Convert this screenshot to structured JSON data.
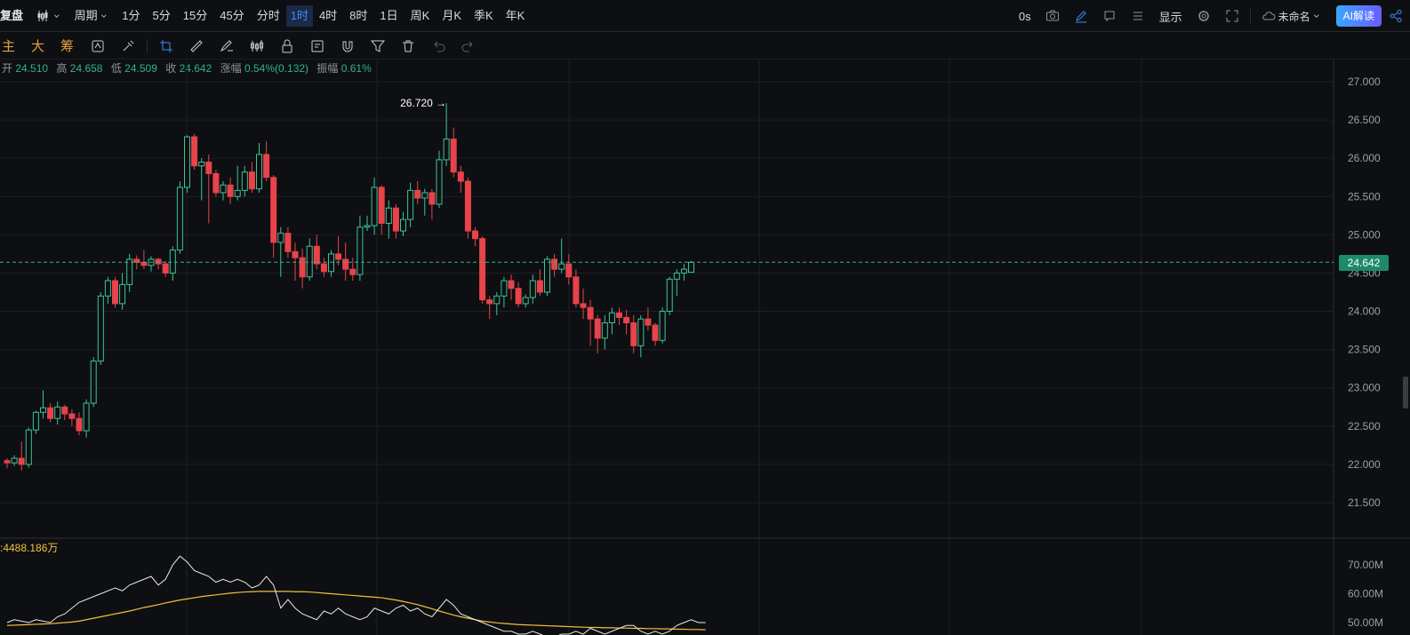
{
  "topbar": {
    "fq": "复盘",
    "period_label": "周期",
    "periods": [
      "1分",
      "5分",
      "15分",
      "45分",
      "分时",
      "1时",
      "4时",
      "8时",
      "1日",
      "周K",
      "月K",
      "季K",
      "年K"
    ],
    "active_period": "1时",
    "right": {
      "seconds": "0s",
      "display": "显示",
      "unnamed": "未命名",
      "ai": "AI解读"
    }
  },
  "toolbar2": {
    "indicators": [
      "主",
      "大",
      "筹"
    ]
  },
  "ohlc": {
    "open_label": "开",
    "open": "24.510",
    "high_label": "高",
    "high": "24.658",
    "low_label": "低",
    "low": "24.509",
    "close_label": "收",
    "close": "24.642",
    "chg_label": "涨幅",
    "chg": "0.54%(0.132)",
    "amp_label": "振幅",
    "amp": "0.61%"
  },
  "max_label": "26.720",
  "last_price": "24.642",
  "volume_label": ":4488.186万",
  "y_ticks": [
    "27.000",
    "26.500",
    "26.000",
    "25.500",
    "25.000",
    "24.500",
    "24.000",
    "23.500",
    "23.000",
    "22.500",
    "22.000",
    "21.500"
  ],
  "vol_ticks": [
    "70.00M",
    "60.00M",
    "50.00M"
  ],
  "colors": {
    "up": "#3cc49a",
    "down": "#e8434b",
    "grid": "#1c1f24",
    "ma": "#f0c23a",
    "line": "#e8e8e8"
  },
  "candles": [
    [
      22.05,
      22.08,
      21.95,
      22.02
    ],
    [
      22.02,
      22.12,
      21.98,
      22.08
    ],
    [
      22.08,
      22.3,
      21.92,
      22.0
    ],
    [
      22.0,
      22.48,
      21.96,
      22.45
    ],
    [
      22.45,
      22.7,
      22.4,
      22.68
    ],
    [
      22.68,
      22.97,
      22.6,
      22.74
    ],
    [
      22.74,
      22.8,
      22.55,
      22.6
    ],
    [
      22.6,
      22.82,
      22.52,
      22.75
    ],
    [
      22.75,
      22.78,
      22.58,
      22.66
    ],
    [
      22.66,
      22.72,
      22.5,
      22.6
    ],
    [
      22.6,
      22.68,
      22.38,
      22.44
    ],
    [
      22.44,
      22.85,
      22.35,
      22.8
    ],
    [
      22.8,
      23.4,
      22.75,
      23.35
    ],
    [
      23.35,
      24.25,
      23.3,
      24.2
    ],
    [
      24.2,
      24.45,
      24.1,
      24.4
    ],
    [
      24.4,
      24.45,
      24.05,
      24.1
    ],
    [
      24.1,
      24.5,
      24.02,
      24.35
    ],
    [
      24.35,
      24.75,
      24.25,
      24.68
    ],
    [
      24.68,
      24.73,
      24.55,
      24.64
    ],
    [
      24.64,
      24.8,
      24.55,
      24.6
    ],
    [
      24.6,
      24.72,
      24.52,
      24.68
    ],
    [
      24.68,
      24.7,
      24.55,
      24.62
    ],
    [
      24.62,
      24.66,
      24.45,
      24.5
    ],
    [
      24.5,
      24.85,
      24.4,
      24.8
    ],
    [
      24.8,
      25.7,
      24.75,
      25.62
    ],
    [
      25.62,
      26.3,
      25.55,
      26.28
    ],
    [
      26.28,
      26.32,
      25.85,
      25.9
    ],
    [
      25.9,
      26.0,
      25.45,
      25.95
    ],
    [
      25.95,
      26.05,
      25.15,
      25.8
    ],
    [
      25.8,
      25.85,
      25.5,
      25.55
    ],
    [
      25.55,
      25.7,
      25.45,
      25.65
    ],
    [
      25.65,
      25.75,
      25.4,
      25.5
    ],
    [
      25.5,
      25.9,
      25.45,
      25.58
    ],
    [
      25.58,
      25.9,
      25.5,
      25.82
    ],
    [
      25.82,
      25.95,
      25.55,
      25.6
    ],
    [
      25.6,
      26.2,
      25.55,
      26.05
    ],
    [
      26.05,
      26.22,
      25.7,
      25.75
    ],
    [
      25.75,
      25.78,
      24.7,
      24.9
    ],
    [
      24.9,
      25.1,
      24.45,
      25.02
    ],
    [
      25.02,
      25.1,
      24.7,
      24.78
    ],
    [
      24.78,
      24.9,
      24.4,
      24.7
    ],
    [
      24.7,
      24.82,
      24.3,
      24.45
    ],
    [
      24.45,
      24.95,
      24.4,
      24.85
    ],
    [
      24.85,
      25.0,
      24.55,
      24.62
    ],
    [
      24.62,
      24.7,
      24.45,
      24.52
    ],
    [
      24.52,
      24.8,
      24.45,
      24.75
    ],
    [
      24.75,
      24.98,
      24.6,
      24.68
    ],
    [
      24.68,
      24.9,
      24.4,
      24.55
    ],
    [
      24.55,
      24.7,
      24.4,
      24.48
    ],
    [
      24.48,
      25.25,
      24.4,
      25.1
    ],
    [
      25.1,
      25.25,
      25.05,
      25.12
    ],
    [
      25.12,
      25.75,
      25.0,
      25.62
    ],
    [
      25.62,
      25.65,
      25.0,
      25.15
    ],
    [
      25.15,
      25.45,
      24.95,
      25.35
    ],
    [
      25.35,
      25.4,
      24.95,
      25.05
    ],
    [
      25.05,
      25.3,
      24.98,
      25.2
    ],
    [
      25.2,
      25.68,
      25.1,
      25.58
    ],
    [
      25.58,
      25.7,
      25.4,
      25.48
    ],
    [
      25.48,
      25.6,
      25.25,
      25.55
    ],
    [
      25.55,
      25.6,
      25.2,
      25.4
    ],
    [
      25.4,
      26.1,
      25.35,
      25.98
    ],
    [
      25.98,
      26.72,
      25.9,
      26.25
    ],
    [
      26.25,
      26.4,
      25.75,
      25.82
    ],
    [
      25.82,
      25.9,
      25.55,
      25.7
    ],
    [
      25.7,
      25.75,
      24.95,
      25.05
    ],
    [
      25.05,
      25.1,
      24.85,
      24.95
    ],
    [
      24.95,
      24.98,
      24.1,
      24.15
    ],
    [
      24.15,
      24.2,
      23.9,
      24.1
    ],
    [
      24.1,
      24.25,
      23.95,
      24.2
    ],
    [
      24.2,
      24.45,
      24.05,
      24.4
    ],
    [
      24.4,
      24.48,
      24.15,
      24.3
    ],
    [
      24.3,
      24.38,
      24.05,
      24.1
    ],
    [
      24.1,
      24.22,
      24.05,
      24.18
    ],
    [
      24.18,
      24.48,
      24.1,
      24.4
    ],
    [
      24.4,
      24.55,
      24.2,
      24.25
    ],
    [
      24.25,
      24.72,
      24.2,
      24.68
    ],
    [
      24.68,
      24.75,
      24.45,
      24.55
    ],
    [
      24.55,
      24.95,
      24.5,
      24.62
    ],
    [
      24.62,
      24.75,
      24.35,
      24.45
    ],
    [
      24.45,
      24.55,
      24.05,
      24.1
    ],
    [
      24.1,
      24.3,
      23.9,
      24.05
    ],
    [
      24.05,
      24.15,
      23.55,
      23.9
    ],
    [
      23.9,
      23.95,
      23.45,
      23.65
    ],
    [
      23.65,
      23.95,
      23.5,
      23.85
    ],
    [
      23.85,
      24.05,
      23.7,
      23.98
    ],
    [
      23.98,
      24.05,
      23.82,
      23.92
    ],
    [
      23.92,
      24.02,
      23.7,
      23.85
    ],
    [
      23.85,
      23.95,
      23.45,
      23.55
    ],
    [
      23.55,
      23.95,
      23.4,
      23.9
    ],
    [
      23.9,
      24.05,
      23.75,
      23.82
    ],
    [
      23.82,
      23.85,
      23.55,
      23.62
    ],
    [
      23.62,
      24.05,
      23.58,
      24.0
    ],
    [
      24.0,
      24.45,
      23.95,
      24.42
    ],
    [
      24.42,
      24.55,
      24.2,
      24.5
    ],
    [
      24.5,
      24.62,
      24.4,
      24.55
    ],
    [
      24.51,
      24.66,
      24.51,
      24.64
    ]
  ],
  "vol_line": [
    50,
    51,
    50.5,
    50,
    51,
    50.5,
    50,
    52,
    53,
    55,
    57,
    58,
    59,
    60,
    61,
    62,
    61,
    63,
    64,
    65,
    66,
    63,
    65,
    70,
    73,
    71,
    68,
    67,
    66,
    64,
    65,
    64,
    65,
    64,
    62,
    63,
    66,
    63,
    55,
    58,
    55,
    53,
    52,
    51,
    54,
    53,
    55,
    53,
    52,
    51,
    52,
    55,
    54,
    53,
    55,
    56,
    54,
    55,
    53,
    52,
    55,
    58,
    56,
    53,
    52,
    51,
    50,
    49,
    48,
    47,
    47,
    46,
    46,
    47,
    46,
    45,
    45,
    46,
    46,
    47,
    46,
    48,
    47,
    46,
    47,
    48,
    49,
    49,
    47,
    46,
    47,
    46,
    47,
    49,
    50,
    51,
    50,
    50
  ],
  "ma_line": [
    49,
    49.1,
    49.2,
    49.3,
    49.4,
    49.5,
    49.6,
    49.8,
    50,
    50.2,
    50.5,
    51,
    51.5,
    52,
    52.5,
    53,
    53.5,
    54,
    54.6,
    55.2,
    55.7,
    56.2,
    56.8,
    57.3,
    57.8,
    58.2,
    58.6,
    59,
    59.3,
    59.6,
    59.9,
    60.2,
    60.4,
    60.6,
    60.7,
    60.8,
    60.8,
    60.8,
    60.8,
    60.8,
    60.7,
    60.7,
    60.6,
    60.4,
    60.2,
    60,
    59.8,
    59.6,
    59.4,
    59.2,
    59,
    58.8,
    58.6,
    58.2,
    57.8,
    57.3,
    56.8,
    56.2,
    55.5,
    54.8,
    54,
    53.3,
    52.6,
    52,
    51.5,
    51,
    50.5,
    50.2,
    49.9,
    49.7,
    49.5,
    49.3,
    49.2,
    49.1,
    49,
    48.9,
    48.8,
    48.7,
    48.6,
    48.5,
    48.4,
    48.3,
    48.3,
    48.2,
    48.2,
    48.1,
    48.1,
    48,
    48,
    47.9,
    47.9,
    47.8,
    47.8,
    47.7,
    47.7,
    47.6,
    47.6,
    47.5
  ]
}
